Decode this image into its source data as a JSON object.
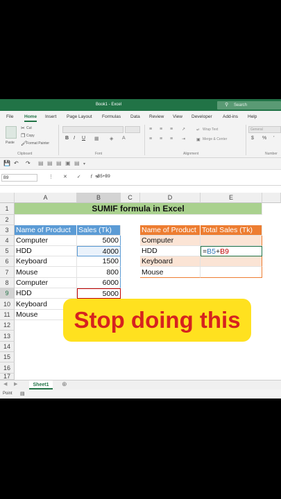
{
  "window": {
    "title": "Book1 - Excel",
    "search_placeholder": "Search"
  },
  "tabs": [
    "File",
    "Home",
    "Insert",
    "Page Layout",
    "Formulas",
    "Data",
    "Review",
    "View",
    "Developer",
    "Add-ins",
    "Help"
  ],
  "ribbon": {
    "paste": "Paste",
    "cut": "Cut",
    "copy": "Copy",
    "format_painter": "Format Painter",
    "clipboard": "Clipboard",
    "font": "Font",
    "wrap_text": "Wrap Text",
    "merge_center": "Merge & Center",
    "alignment": "Alignment",
    "number_format": "General",
    "currency": "$",
    "percent": "%",
    "number": "Number",
    "bold": "B",
    "italic": "I",
    "underline": "U"
  },
  "formula_bar": {
    "name_box": "B9",
    "formula": "=B5+B9"
  },
  "columns": [
    "A",
    "B",
    "C",
    "D",
    "E"
  ],
  "rows": [
    "1",
    "2",
    "3",
    "4",
    "5",
    "6",
    "7",
    "8",
    "9",
    "10",
    "11",
    "12",
    "13",
    "14",
    "15",
    "16",
    "17"
  ],
  "sheet": {
    "title": "SUMIF formula in Excel",
    "table1": {
      "headers": [
        "Name of Product",
        "Sales (Tk)"
      ],
      "rows": [
        [
          "Computer",
          "5000"
        ],
        [
          "HDD",
          "4000"
        ],
        [
          "Keyboard",
          "1500"
        ],
        [
          "Mouse",
          "800"
        ],
        [
          "Computer",
          "6000"
        ],
        [
          "HDD",
          "5000"
        ],
        [
          "Keyboard",
          ""
        ],
        [
          "Mouse",
          ""
        ]
      ]
    },
    "table2": {
      "headers": [
        "Name of Product",
        "Total Sales (Tk)"
      ],
      "rows": [
        [
          "Computer",
          ""
        ],
        [
          "HDD",
          "=B5+B9"
        ],
        [
          "Keyboard",
          ""
        ],
        [
          "Mouse",
          ""
        ]
      ]
    }
  },
  "sheet_tab": "Sheet1",
  "status": "Point",
  "overlay_text": "Stop doing this",
  "colors": {
    "excel_green": "#217346",
    "title_green": "#a9d18e",
    "blue_header": "#5b9bd5",
    "orange_header": "#ed7d31",
    "light_orange": "#fbe4d5",
    "overlay_yellow": "#ffe11f",
    "overlay_red": "#d6221f"
  }
}
